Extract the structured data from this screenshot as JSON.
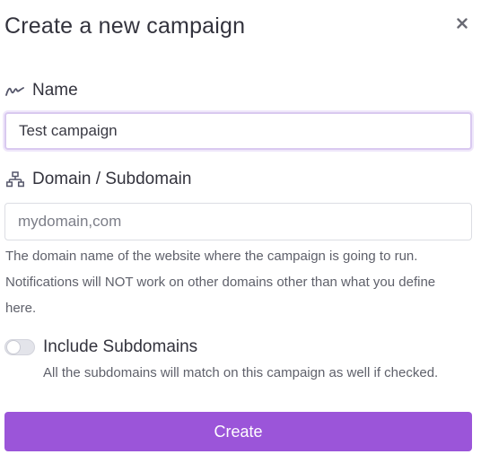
{
  "modal": {
    "title": "Create a new campaign",
    "close_icon": "close-icon"
  },
  "name": {
    "label": "Name",
    "icon": "signature-icon",
    "value": "Test campaign",
    "placeholder": ""
  },
  "domain": {
    "label": "Domain / Subdomain",
    "icon": "sitemap-icon",
    "value": "",
    "placeholder": "mydomain,com",
    "help": "The domain name of the website where the campaign is going to run. Notifications will NOT work on other domains other than what you define here."
  },
  "subdomains": {
    "label": "Include Subdomains",
    "checked": false,
    "help": "All the subdomains will match on this campaign as well if checked."
  },
  "actions": {
    "create_label": "Create"
  },
  "colors": {
    "accent": "#9b55d9",
    "focus_border": "#d9c9f0"
  }
}
